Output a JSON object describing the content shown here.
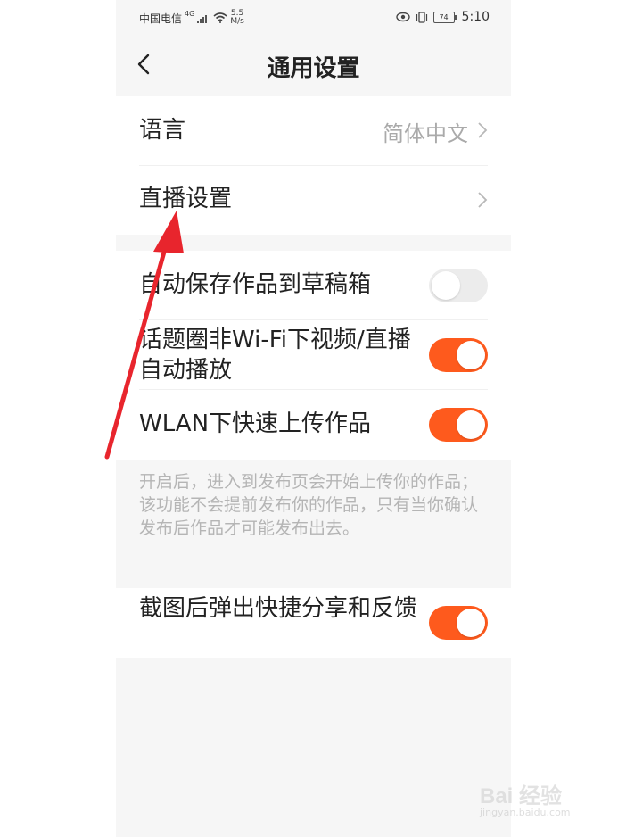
{
  "status_bar": {
    "carrier": "中国电信",
    "network": "4G",
    "speed_top": "5.5",
    "speed_bottom": "M/s",
    "battery": "74",
    "time": "5:10"
  },
  "header": {
    "title": "通用设置"
  },
  "section1": {
    "items": [
      {
        "label": "语言",
        "value": "简体中文"
      },
      {
        "label": "直播设置",
        "value": ""
      }
    ]
  },
  "section2": {
    "items": [
      {
        "label": "自动保存作品到草稿箱",
        "enabled": false
      },
      {
        "label": "话题圈非Wi-Fi下视频/直播自动播放",
        "enabled": true
      },
      {
        "label": "WLAN下快速上传作品",
        "enabled": true
      }
    ],
    "note": "开启后，进入到发布页会开始上传你的作品；该功能不会提前发布你的作品，只有当你确认发布后作品才可能发布出去。"
  },
  "section3": {
    "items": [
      {
        "label": "截图后弹出快捷分享和反馈",
        "enabled": true
      }
    ]
  },
  "watermark": {
    "brand": "Bai 经验",
    "url": "jingyan.baidu.com"
  },
  "colors": {
    "accent": "#fe5a1d",
    "annotation_arrow": "#e8252d"
  }
}
